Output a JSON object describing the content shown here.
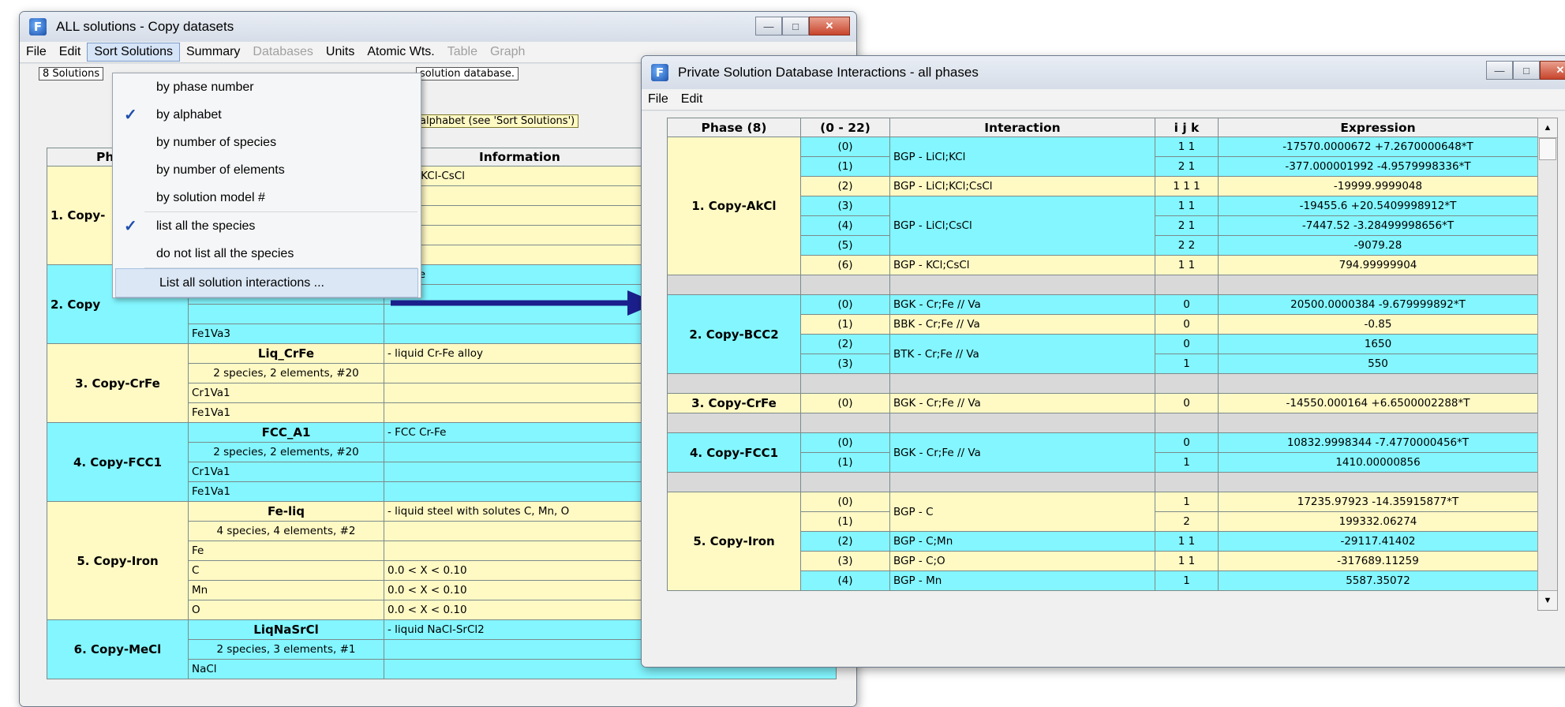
{
  "win1": {
    "title": "ALL solutions  - Copy datasets",
    "menu": [
      "File",
      "Edit",
      "Sort Solutions",
      "Summary",
      "Databases",
      "Units",
      "Atomic Wts.",
      "Table",
      "Graph"
    ],
    "solutions_box": "8 Solutions",
    "db_box": "solution database.",
    "sort_box": "alphabet  (see 'Sort Solutions')",
    "headers": {
      "phase": "Ph",
      "information": "Information"
    },
    "rows": [
      {
        "phase": "1. Copy-",
        "info": "d LiCl-KCl-CsCl"
      },
      {
        "phase": "2. Copy",
        "info": "C Cr-Fe"
      },
      {
        "phase": "3. Copy-CrFe",
        "model": "Liq_CrFe",
        "info": "- liquid Cr-Fe alloy",
        "species": "2 species, 2 elements, #20",
        "s1": "Cr1Va1",
        "s2": "Fe1Va1"
      },
      {
        "phase": "4. Copy-FCC1",
        "model": "FCC_A1",
        "info": "- FCC Cr-Fe",
        "species": "2 species, 2 elements, #20",
        "s1": "Cr1Va1",
        "s2": "Fe1Va1"
      },
      {
        "phase": "5. Copy-Iron",
        "model": "Fe-liq",
        "info": "- liquid steel with solutes C, Mn, O",
        "species": "4 species, 4 elements, #2",
        "s1": "Fe",
        "s2": "C",
        "s3": "Mn",
        "s4": "O",
        "r2": "0.0  <  X  <  0.10",
        "r3": "0.0  <  X  <  0.10",
        "r4": "0.0  <  X  <  0.10"
      },
      {
        "phase": "6. Copy-MeCl",
        "model": "LiqNaSrCl",
        "info": "- liquid NaCl-SrCl2",
        "species": "2 species, 3 elements, #1",
        "s1": "NaCl"
      }
    ],
    "row2_extra": "Fe1Va3"
  },
  "dropdown": {
    "items": [
      "by phase number",
      "by alphabet",
      "by number of species",
      "by number of elements",
      "by solution model #",
      "list all the species",
      "do not list all the species",
      "List all solution interactions ..."
    ],
    "checked": [
      1,
      5
    ]
  },
  "win2": {
    "title": "Private Solution Database Interactions - all phases",
    "menu": [
      "File",
      "Edit"
    ],
    "headers": {
      "phase": "Phase  (8)",
      "idx": "(0 - 22)",
      "interaction": "Interaction",
      "ijk": "i  j  k",
      "expr": "Expression"
    },
    "phases": [
      "1. Copy-AkCl",
      "2. Copy-BCC2",
      "3. Copy-CrFe",
      "4. Copy-FCC1",
      "5. Copy-Iron"
    ],
    "g1": [
      {
        "idx": "(0)",
        "ijk": "1 1",
        "expr": "-17570.0000672 +7.2670000648*T"
      },
      {
        "idx": "(1)",
        "ijk": "2 1",
        "expr": "-377.000001992 -4.9579998336*T"
      },
      {
        "idx": "(2)",
        "ijk": "1 1 1",
        "expr": "-19999.9999048"
      },
      {
        "idx": "(3)",
        "ijk": "1 1",
        "expr": "-19455.6 +20.5409998912*T"
      },
      {
        "idx": "(4)",
        "ijk": "2 1",
        "expr": "-7447.52 -3.28499998656*T"
      },
      {
        "idx": "(5)",
        "ijk": "2 2",
        "expr": "-9079.28"
      },
      {
        "idx": "(6)",
        "ijk": "1 1",
        "expr": "794.99999904"
      }
    ],
    "g1_int": [
      "BGP - LiCl;KCl",
      "BGP - LiCl;KCl;CsCl",
      "BGP - LiCl;CsCl",
      "BGP - KCl;CsCl"
    ],
    "g2": [
      {
        "idx": "(0)",
        "int": "BGK - Cr;Fe // Va",
        "ijk": "0",
        "expr": "20500.0000384 -9.679999892*T"
      },
      {
        "idx": "(1)",
        "int": "BBK - Cr;Fe // Va",
        "ijk": "0",
        "expr": "-0.85"
      },
      {
        "idx": "(2)",
        "ijk": "0",
        "expr": "1650"
      },
      {
        "idx": "(3)",
        "ijk": "1",
        "expr": "550"
      }
    ],
    "g2_int_btk": "BTK - Cr;Fe // Va",
    "g3": {
      "idx": "(0)",
      "int": "BGK - Cr;Fe // Va",
      "ijk": "0",
      "expr": "-14550.000164 +6.6500002288*T"
    },
    "g4": [
      {
        "idx": "(0)",
        "ijk": "0",
        "expr": "10832.9998344 -7.4770000456*T"
      },
      {
        "idx": "(1)",
        "ijk": "1",
        "expr": "1410.00000856"
      }
    ],
    "g4_int": "BGK - Cr;Fe // Va",
    "g5": [
      {
        "idx": "(0)",
        "ijk": "1",
        "expr": "17235.97923 -14.35915877*T"
      },
      {
        "idx": "(1)",
        "ijk": "2",
        "expr": "199332.06274"
      },
      {
        "idx": "(2)",
        "int": "BGP - C;Mn",
        "ijk": "1 1",
        "expr": "-29117.41402"
      },
      {
        "idx": "(3)",
        "int": "BGP - C;O",
        "ijk": "1 1",
        "expr": "-317689.11259"
      },
      {
        "idx": "(4)",
        "int": "BGP - Mn",
        "ijk": "1",
        "expr": "5587.35072"
      }
    ],
    "g5_int_c": "BGP - C"
  },
  "colors": {
    "cyan": "#83f6ff",
    "yellow": "#fff9c4",
    "arrow": "#1b1f8c"
  }
}
